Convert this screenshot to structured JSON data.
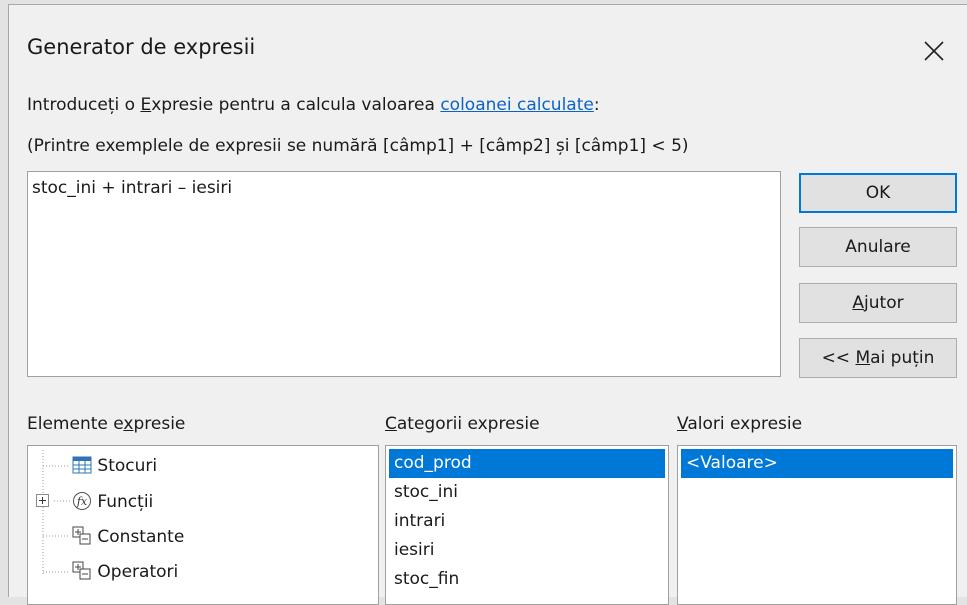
{
  "dialog": {
    "title": "Generator de expresii",
    "intro": {
      "pre": "Introduceți o ",
      "E": "E",
      "mid": "xpresie pentru a calcula valoarea ",
      "link": "coloanei calculate",
      "end": ":"
    },
    "hint": "(Printre exemplele de expresii se numără [câmp1] + [câmp2] și [câmp1] < 5)",
    "expression_value": "stoc_ini + intrari – iesiri"
  },
  "buttons": {
    "ok": "OK",
    "cancel": "Anulare",
    "help_u": "A",
    "help_rest": "jutor",
    "less_pre": "<< ",
    "less_u": "M",
    "less_rest": "ai puțin"
  },
  "sections": {
    "elements": {
      "pre": "Elemente e",
      "u": "x",
      "rest": "presie"
    },
    "categories": {
      "u": "C",
      "rest": "ategorii expresie"
    },
    "values": {
      "u": "V",
      "rest": "alori expresie"
    }
  },
  "tree": [
    {
      "label": "Stocuri",
      "icon": "table-icon"
    },
    {
      "label": "Funcții",
      "icon": "function-icon",
      "expandable": true
    },
    {
      "label": "Constante",
      "icon": "constants-icon"
    },
    {
      "label": "Operatori",
      "icon": "operators-icon"
    }
  ],
  "categories": [
    "cod_prod",
    "stoc_ini",
    "intrari",
    "iesiri",
    "stoc_fin"
  ],
  "values": [
    "<Valoare>"
  ],
  "colors": {
    "selection": "#0078d7",
    "link": "#0b63c5",
    "default_button_border": "#0078d7"
  }
}
